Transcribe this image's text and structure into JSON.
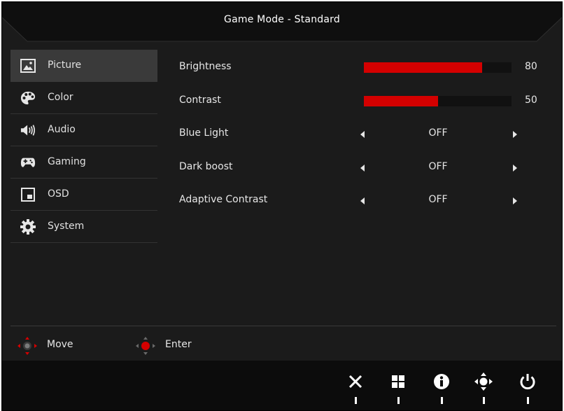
{
  "title": "Game Mode - Standard",
  "colors": {
    "accent": "#d40000",
    "background": "#1b1b1b",
    "active_item": "#3a3a3a",
    "text": "#e6e6e6"
  },
  "sidebar": {
    "items": [
      {
        "label": "Picture",
        "icon": "picture-icon",
        "active": true
      },
      {
        "label": "Color",
        "icon": "palette-icon",
        "active": false
      },
      {
        "label": "Audio",
        "icon": "speaker-icon",
        "active": false
      },
      {
        "label": "Gaming",
        "icon": "gamepad-icon",
        "active": false
      },
      {
        "label": "OSD",
        "icon": "osd-window-icon",
        "active": false
      },
      {
        "label": "System",
        "icon": "gear-icon",
        "active": false
      }
    ]
  },
  "settings": {
    "brightness": {
      "label": "Brightness",
      "value": "80",
      "level": 0.8
    },
    "contrast": {
      "label": "Contrast",
      "value": "50",
      "level": 0.5
    },
    "blue_light": {
      "label": "Blue Light",
      "value": "OFF"
    },
    "dark_boost": {
      "label": "Dark boost",
      "value": "OFF"
    },
    "adaptive_contrast": {
      "label": "Adaptive Contrast",
      "value": "OFF"
    }
  },
  "hints": {
    "move": "Move",
    "enter": "Enter"
  },
  "buttons": [
    {
      "icon": "close-icon"
    },
    {
      "icon": "menu-grid-icon"
    },
    {
      "icon": "info-icon"
    },
    {
      "icon": "navigation-pad-icon"
    },
    {
      "icon": "power-icon"
    }
  ]
}
